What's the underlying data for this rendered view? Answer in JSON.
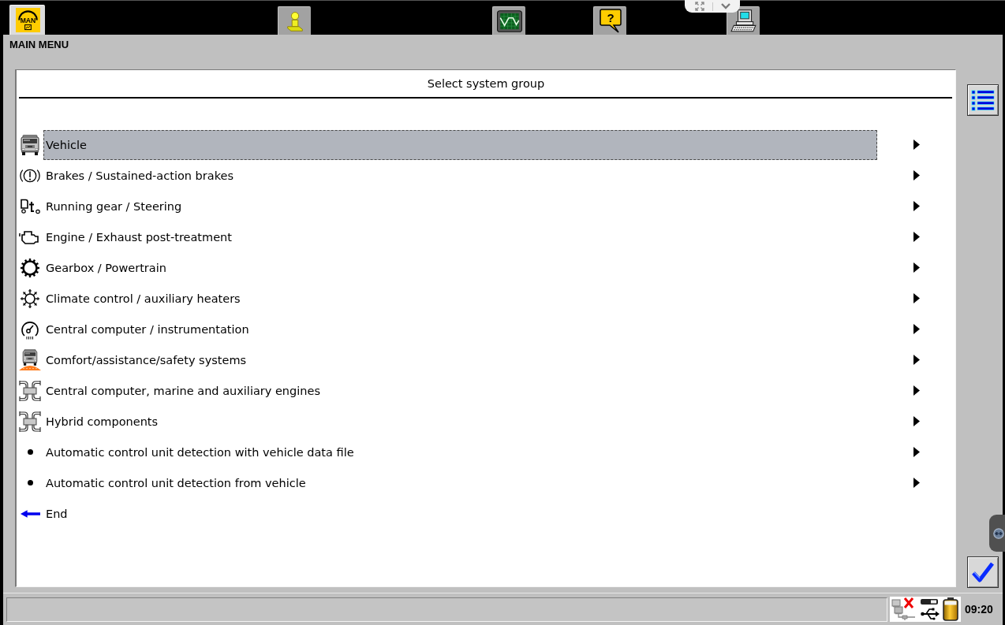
{
  "toolbar_tabs": [
    {
      "kind": "logo",
      "label": "MAN",
      "selected": true
    },
    {
      "kind": "info",
      "selected": false
    },
    {
      "kind": "scope",
      "selected": false
    },
    {
      "kind": "help",
      "label": "?",
      "selected": false
    },
    {
      "kind": "computer",
      "selected": false
    }
  ],
  "window": {
    "title": "MAIN MENU"
  },
  "panel": {
    "title": "Select system group"
  },
  "menu_items": [
    {
      "kind": "truck",
      "label": "Vehicle",
      "selected": true,
      "submenu": true
    },
    {
      "kind": "brake",
      "label": "Brakes / Sustained-action brakes",
      "selected": false,
      "submenu": true
    },
    {
      "kind": "chassis",
      "label": "Running gear / Steering",
      "selected": false,
      "submenu": true
    },
    {
      "kind": "engine",
      "label": "Engine / Exhaust post-treatment",
      "selected": false,
      "submenu": true
    },
    {
      "kind": "gearbox",
      "label": "Gearbox / Powertrain",
      "selected": false,
      "submenu": true
    },
    {
      "kind": "climate",
      "label": "Climate control / auxiliary heaters",
      "selected": false,
      "submenu": true
    },
    {
      "kind": "gauge",
      "label": "Central computer / instrumentation",
      "selected": false,
      "submenu": true
    },
    {
      "kind": "safety",
      "label": "Comfort/assistance/safety systems",
      "selected": false,
      "submenu": true
    },
    {
      "kind": "harness",
      "label": "Central computer, marine and auxiliary engines",
      "selected": false,
      "submenu": true
    },
    {
      "kind": "harness",
      "label": "Hybrid components",
      "selected": false,
      "submenu": true
    },
    {
      "kind": "bullet",
      "label": "Automatic control unit detection with vehicle data file",
      "selected": false,
      "submenu": true
    },
    {
      "kind": "bullet",
      "label": "Automatic control unit detection from vehicle",
      "selected": false,
      "submenu": true
    },
    {
      "kind": "back",
      "label": "End",
      "selected": false,
      "submenu": false
    }
  ],
  "status_bar": {
    "network_connected": false,
    "time": "09:20"
  }
}
